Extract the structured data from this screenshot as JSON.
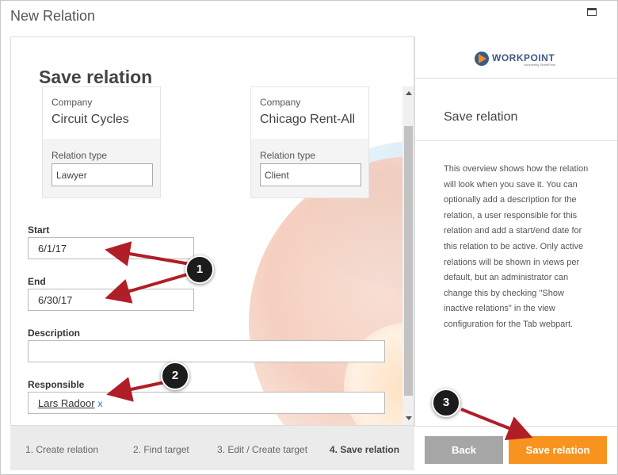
{
  "window": {
    "title": "New Relation"
  },
  "main": {
    "heading": "Save relation",
    "card_left": {
      "company_label": "Company",
      "company_value": "Circuit Cycles",
      "relation_type_label": "Relation type",
      "relation_type_value": "Lawyer"
    },
    "card_right": {
      "company_label": "Company",
      "company_value": "Chicago Rent-All",
      "relation_type_label": "Relation type",
      "relation_type_value": "Client"
    },
    "start": {
      "label": "Start",
      "value": "6/1/17"
    },
    "end": {
      "label": "End",
      "value": "6/30/17"
    },
    "description": {
      "label": "Description",
      "value": ""
    },
    "responsible": {
      "label": "Responsible",
      "value": "Lars Radoor",
      "remove": "x"
    }
  },
  "side": {
    "logo_text": "WORKPOINT",
    "logo_tagline": "completing SharePoint",
    "title": "Save relation",
    "description": "This overview shows how the relation will look when you save it. You can optionally add a description for the relation, a user responsible for this relation and add a start/end date for this relation to be active. Only active relations will be shown in views per default, but an administrator can change this by checking \"Show inactive relations\" in the view configuration for the Tab webpart."
  },
  "steps": [
    {
      "label": "1. Create relation",
      "active": false
    },
    {
      "label": "2. Find target",
      "active": false
    },
    {
      "label": "3. Edit / Create target",
      "active": false
    },
    {
      "label": "4. Save relation",
      "active": true
    }
  ],
  "buttons": {
    "back": "Back",
    "save": "Save relation"
  },
  "annotations": {
    "badge1": "1",
    "badge2": "2",
    "badge3": "3"
  },
  "colors": {
    "accent": "#f7931e",
    "arrow": "#b01e28",
    "back_button": "#a6a6a6",
    "footer_bg": "#ebebeb"
  }
}
